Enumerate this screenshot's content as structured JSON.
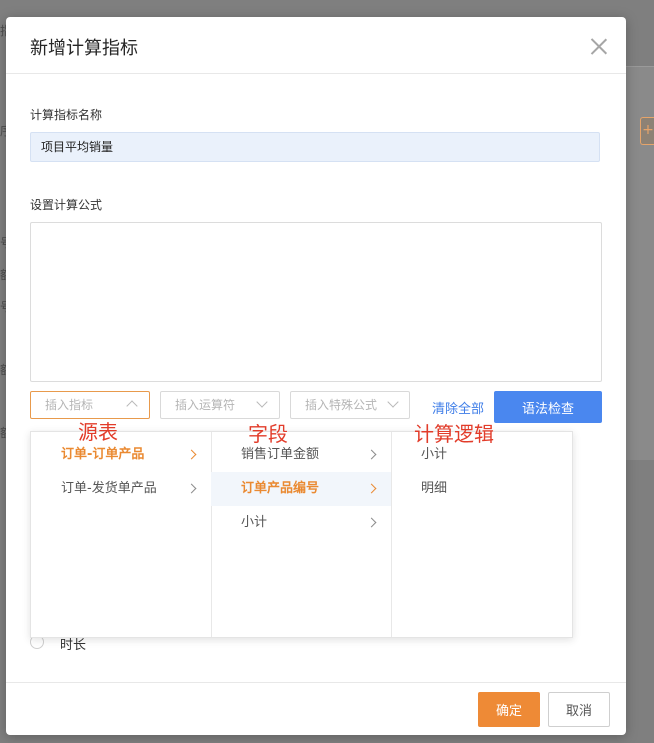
{
  "background": {
    "glyphs": [
      "指",
      "序",
      "号",
      "额",
      "号",
      "额",
      "额"
    ]
  },
  "dialog": {
    "title": "新增计算指标",
    "name_label": "计算指标名称",
    "name_value": "项目平均销量",
    "formula_label": "设置计算公式",
    "formula_value": "",
    "insert_indicator_placeholder": "插入指标",
    "insert_operator_placeholder": "插入运算符",
    "insert_special_placeholder": "插入特殊公式",
    "clear_all": "清除全部",
    "syntax_check": "语法检查",
    "option_duration": "时长",
    "ok": "确定",
    "cancel": "取消"
  },
  "cascader": {
    "source_tables": [
      {
        "label": "订单-订单产品",
        "selected": true
      },
      {
        "label": "订单-发货单产品",
        "selected": false
      }
    ],
    "fields": [
      {
        "label": "销售订单金额",
        "selected": false
      },
      {
        "label": "订单产品编号",
        "selected": true
      },
      {
        "label": "小计",
        "selected": false
      }
    ],
    "logic": [
      {
        "label": "小计"
      },
      {
        "label": "明细"
      }
    ]
  },
  "annotations": {
    "source_table": "源表",
    "field": "字段",
    "calc_logic": "计算逻辑"
  },
  "colors": {
    "accent": "#ee8a36",
    "primary": "#4a87ef",
    "annotation": "#e23c2a"
  }
}
